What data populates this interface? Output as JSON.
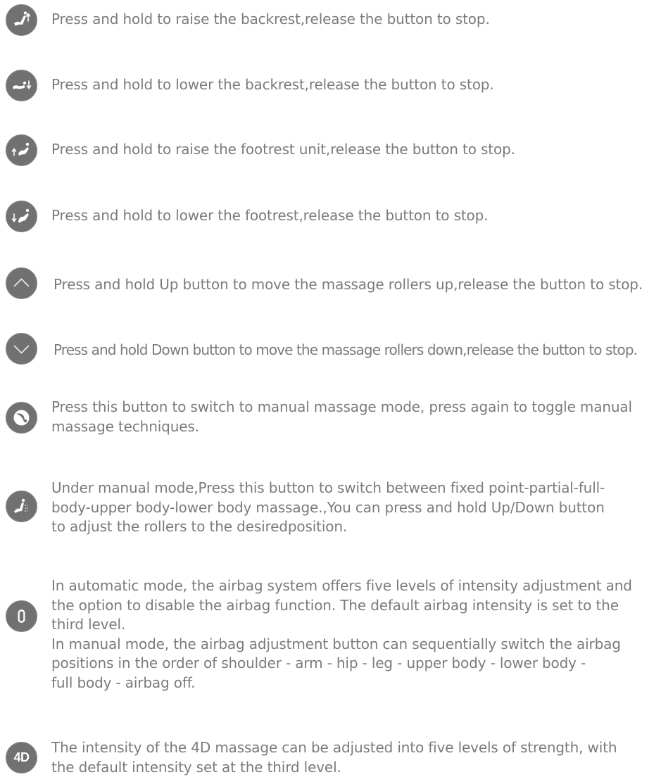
{
  "items": [
    {
      "icon": "backrest-raise-icon",
      "text": "Press and hold to raise the backrest,release the button to stop."
    },
    {
      "icon": "backrest-lower-icon",
      "text": "Press and hold to lower the backrest,release the button to stop."
    },
    {
      "icon": "footrest-raise-icon",
      "text": "Press and hold to raise the footrest unit,release the button to stop."
    },
    {
      "icon": "footrest-lower-icon",
      "text": "Press and hold to lower the footrest,release the button to stop."
    },
    {
      "icon": "chevron-up-icon",
      "text": "Press and hold Up button to move the massage rollers up,release the button to stop."
    },
    {
      "icon": "chevron-down-icon",
      "text": "Press and hold Down button to move the massage rollers down,release the button to stop."
    },
    {
      "icon": "manual-mode-icon",
      "lines": [
        "Press this button to switch to manual massage mode, press again to toggle manual",
        "massage techniques."
      ]
    },
    {
      "icon": "body-part-icon",
      "lines": [
        "Under manual mode,Press this button to switch between fixed point-partial-full-",
        "body-upper body-lower body massage.,You can press and hold Up/Down button",
        "to adjust the rollers to the desiredposition."
      ]
    },
    {
      "icon": "airbag-icon",
      "para1": [
        "In automatic mode, the airbag system offers five levels of intensity adjustment and",
        "the option to disable the airbag function. The default airbag intensity is set to the",
        "third level."
      ],
      "para2": [
        "In manual mode, the airbag adjustment button can sequentially switch the airbag",
        "positions in the order of shoulder - arm - hip - leg - upper body - lower body -",
        "full body - airbag off."
      ]
    },
    {
      "icon": "4d-intensity-icon",
      "badge": "4D",
      "lines": [
        "The intensity of the 4D massage can be adjusted into five levels of strength, with",
        "the default intensity set at the third level."
      ]
    }
  ]
}
